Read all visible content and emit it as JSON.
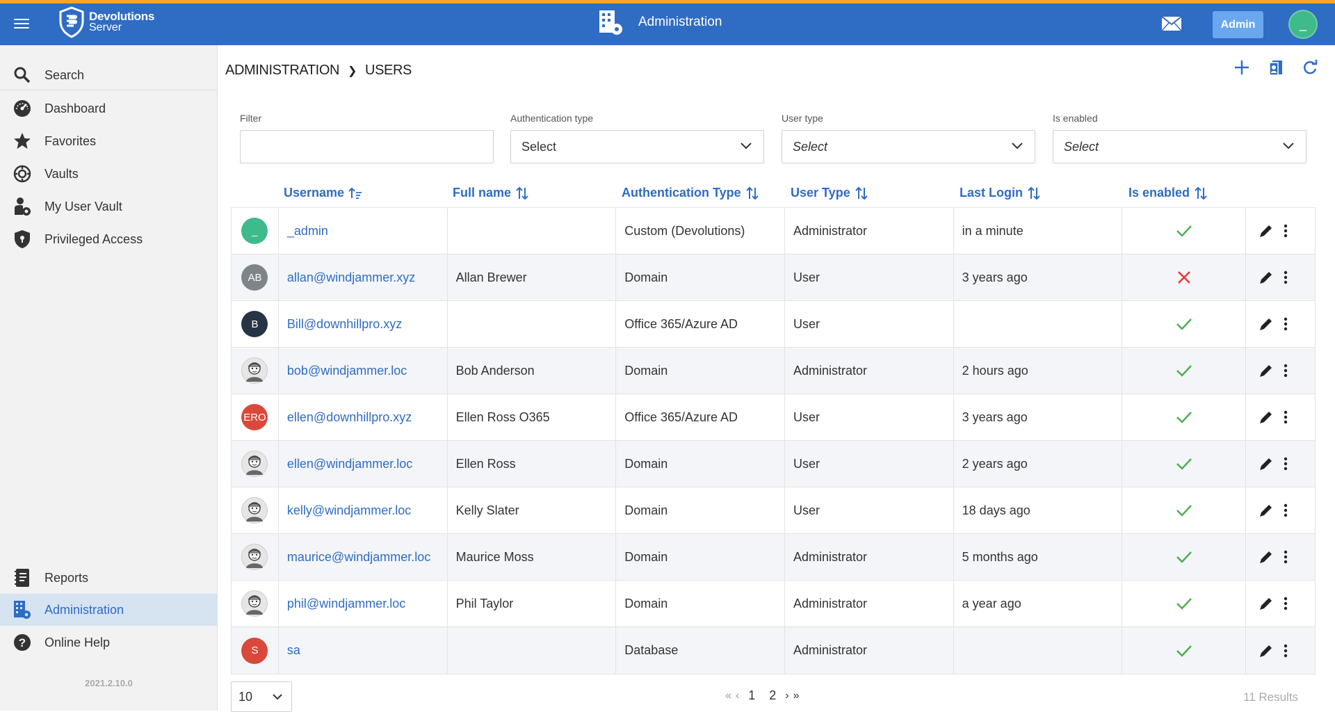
{
  "app": {
    "brand_line1": "Devolutions",
    "brand_line2": "Server",
    "section_title": "Administration",
    "admin_label": "Admin",
    "avatar_initial": "_"
  },
  "sidebar": {
    "items": [
      {
        "label": "Search",
        "icon": "search-icon"
      },
      {
        "label": "Dashboard",
        "icon": "dashboard-gauge-icon"
      },
      {
        "label": "Favorites",
        "icon": "star-icon"
      },
      {
        "label": "Vaults",
        "icon": "vault-icon"
      },
      {
        "label": "My User Vault",
        "icon": "user-vault-icon"
      },
      {
        "label": "Privileged Access",
        "icon": "shield-icon"
      },
      {
        "label": "Reports",
        "icon": "reports-icon"
      },
      {
        "label": "Administration",
        "icon": "administration-icon"
      },
      {
        "label": "Online Help",
        "icon": "help-icon"
      }
    ],
    "version": "2021.2.10.0"
  },
  "breadcrumb": {
    "root": "ADMINISTRATION",
    "current": "USERS"
  },
  "filters": {
    "filter_label": "Filter",
    "filter_value": "",
    "auth_label": "Authentication type",
    "auth_value": "Select",
    "usertype_label": "User type",
    "usertype_value": "Select",
    "enabled_label": "Is enabled",
    "enabled_value": "Select"
  },
  "columns": [
    "Username",
    "Full name",
    "Authentication Type",
    "User Type",
    "Last Login",
    "Is enabled"
  ],
  "rows": [
    {
      "avatar": "_",
      "avatar_color": "#3fba8a",
      "username": "_admin",
      "full_name": "",
      "auth": "Custom (Devolutions)",
      "type": "Administrator",
      "last": "in a minute",
      "enabled": true
    },
    {
      "avatar": "AB",
      "avatar_color": "#7d8588",
      "username": "allan@windjammer.xyz",
      "full_name": "Allan Brewer",
      "auth": "Domain",
      "type": "User",
      "last": "3 years ago",
      "enabled": false
    },
    {
      "avatar": "B",
      "avatar_color": "#263445",
      "username": "Bill@downhillpro.xyz",
      "full_name": "",
      "auth": "Office 365/Azure AD",
      "type": "User",
      "last": "",
      "enabled": true
    },
    {
      "avatar": "",
      "avatar_color": "pic",
      "username": "bob@windjammer.loc",
      "full_name": "Bob Anderson",
      "auth": "Domain",
      "type": "Administrator",
      "last": "2 hours ago",
      "enabled": true
    },
    {
      "avatar": "ERO",
      "avatar_color": "#d9483b",
      "username": "ellen@downhillpro.xyz",
      "full_name": "Ellen Ross O365",
      "auth": "Office 365/Azure AD",
      "type": "User",
      "last": "3 years ago",
      "enabled": true
    },
    {
      "avatar": "",
      "avatar_color": "pic",
      "username": "ellen@windjammer.loc",
      "full_name": "Ellen Ross",
      "auth": "Domain",
      "type": "User",
      "last": "2 years ago",
      "enabled": true
    },
    {
      "avatar": "",
      "avatar_color": "pic",
      "username": "kelly@windjammer.loc",
      "full_name": "Kelly Slater",
      "auth": "Domain",
      "type": "User",
      "last": "18 days ago",
      "enabled": true
    },
    {
      "avatar": "",
      "avatar_color": "pic",
      "username": "maurice@windjammer.loc",
      "full_name": "Maurice Moss",
      "auth": "Domain",
      "type": "Administrator",
      "last": "5 months ago",
      "enabled": true
    },
    {
      "avatar": "",
      "avatar_color": "pic",
      "username": "phil@windjammer.loc",
      "full_name": "Phil Taylor",
      "auth": "Domain",
      "type": "Administrator",
      "last": "a year ago",
      "enabled": true
    },
    {
      "avatar": "S",
      "avatar_color": "#d9483b",
      "username": "sa",
      "full_name": "",
      "auth": "Database",
      "type": "Administrator",
      "last": "",
      "enabled": true
    }
  ],
  "pagination": {
    "page_size": "10",
    "pages": [
      "1",
      "2"
    ],
    "results": "11 Results"
  },
  "colors": {
    "brand": "#2f6cc4",
    "accent": "#f5a623",
    "check": "#4caf50",
    "cross": "#e53935"
  }
}
